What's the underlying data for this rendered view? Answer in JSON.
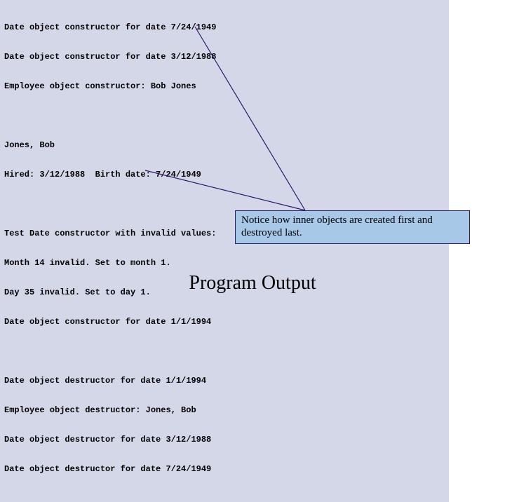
{
  "block1": {
    "l1": "Date object constructor for date 7/24/1949",
    "l2": "Date object constructor for date 3/12/1988",
    "l3": "Employee object constructor: Bob Jones"
  },
  "block2": {
    "l1": "Jones, Bob",
    "l2": "Hired: 3/12/1988  Birth date: 7/24/1949"
  },
  "block3": {
    "l1": "Test Date constructor with invalid values:",
    "l2": "Month 14 invalid. Set to month 1.",
    "l3": "Day 35 invalid. Set to day 1.",
    "l4": "Date object constructor for date 1/1/1994"
  },
  "block4": {
    "l1": "Date object destructor for date 1/1/1994",
    "l2": "Employee object destructor: Jones, Bob",
    "l3": "Date object destructor for date 3/12/1988",
    "l4": "Date object destructor for date 7/24/1949"
  },
  "note": {
    "line1": "Notice how inner objects are created first and",
    "line2": "destroyed last."
  },
  "title": "Program Output"
}
